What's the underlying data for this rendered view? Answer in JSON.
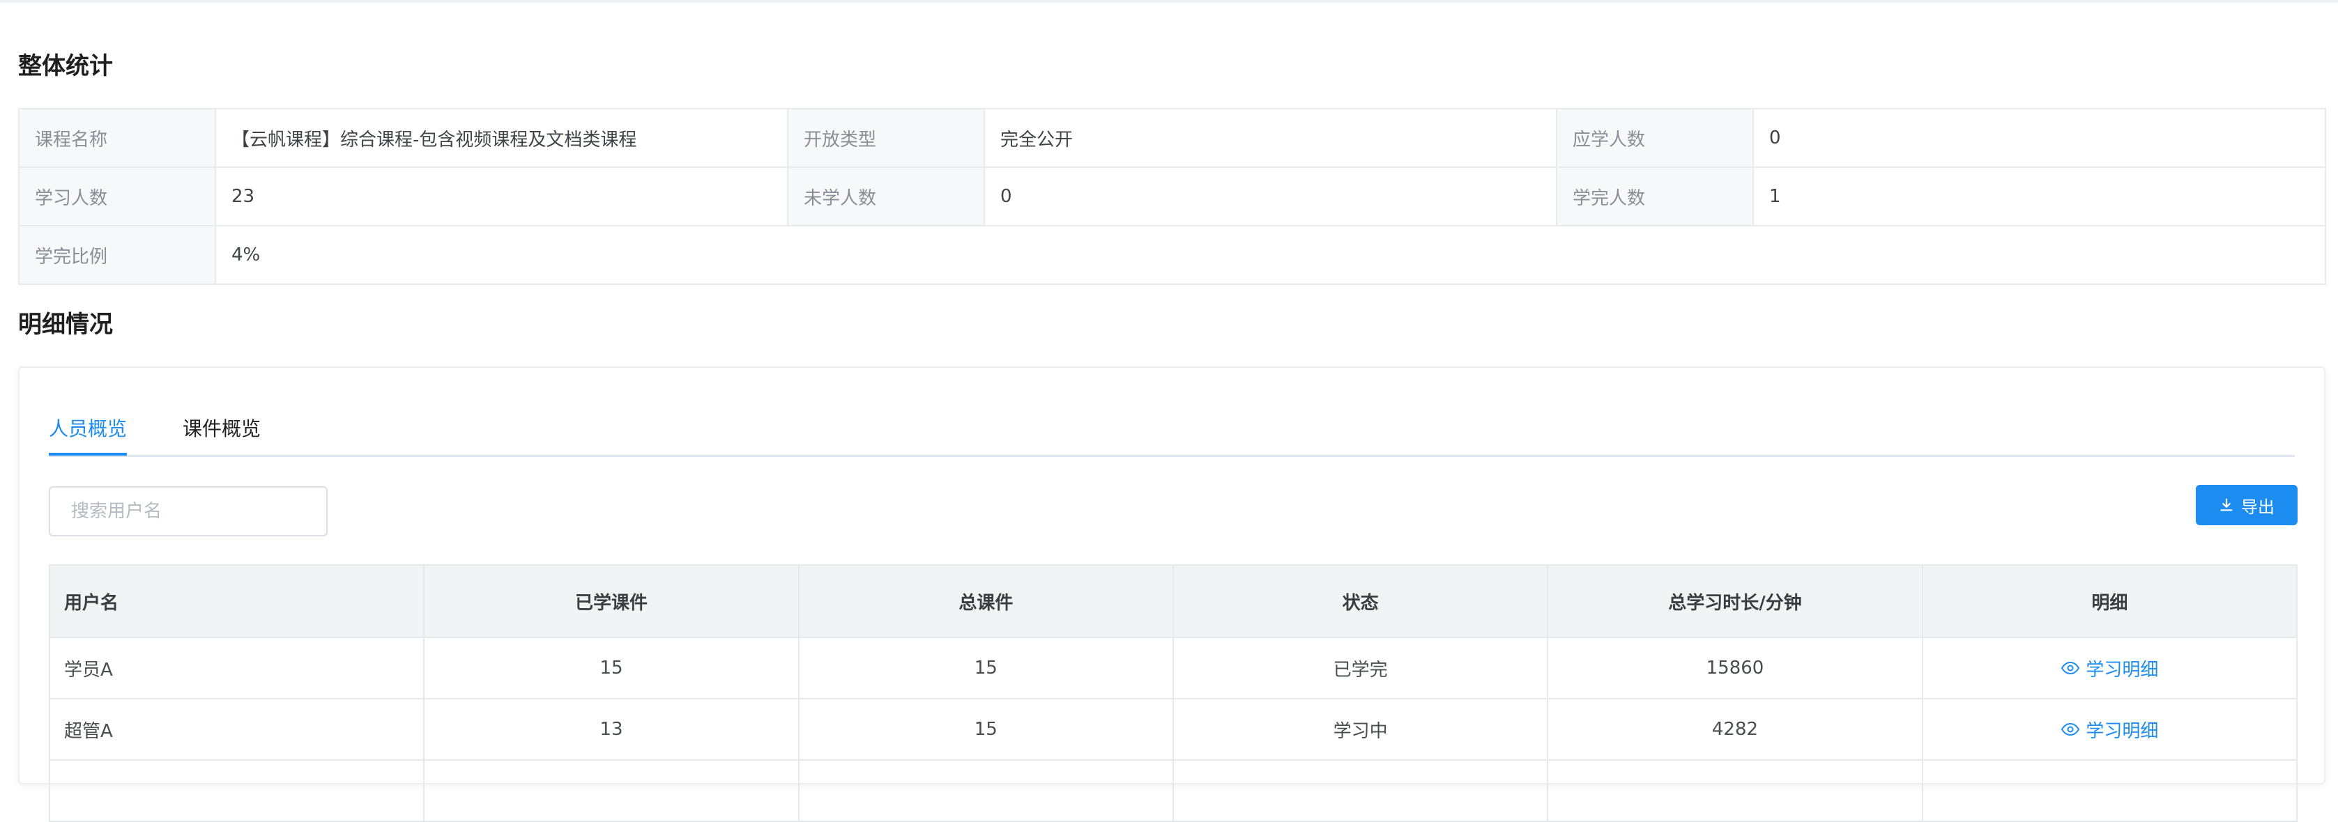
{
  "overall": {
    "title": "整体统计",
    "rows": [
      [
        {
          "label": "课程名称",
          "value": "【云帆课程】综合课程-包含视频课程及文档类课程"
        },
        {
          "label": "开放类型",
          "value": "完全公开"
        },
        {
          "label": "应学人数",
          "value": "0"
        }
      ],
      [
        {
          "label": "学习人数",
          "value": "23"
        },
        {
          "label": "未学人数",
          "value": "0"
        },
        {
          "label": "学完人数",
          "value": "1"
        }
      ],
      [
        {
          "label": "学完比例",
          "value": "4%"
        }
      ]
    ]
  },
  "detail": {
    "title": "明细情况",
    "tabs": [
      "人员概览",
      "课件概览"
    ],
    "active_tab": "人员概览",
    "search": {
      "placeholder": "搜索用户名",
      "value": ""
    },
    "export_label": "导出",
    "table": {
      "headers": [
        "用户名",
        "已学课件",
        "总课件",
        "状态",
        "总学习时长/分钟",
        "明细"
      ],
      "rows": [
        {
          "user": "学员A",
          "learned": "15",
          "total": "15",
          "status": "已学完",
          "minutes": "15860",
          "detail": "学习明细"
        },
        {
          "user": "超管A",
          "learned": "13",
          "total": "15",
          "status": "学习中",
          "minutes": "4282",
          "detail": "学习明细"
        }
      ]
    }
  },
  "colors": {
    "accent": "#1c8cf0",
    "done": "#22a33c",
    "learning": "#f24848"
  },
  "icons": {
    "export": "download-icon",
    "detail": "eye-icon"
  }
}
